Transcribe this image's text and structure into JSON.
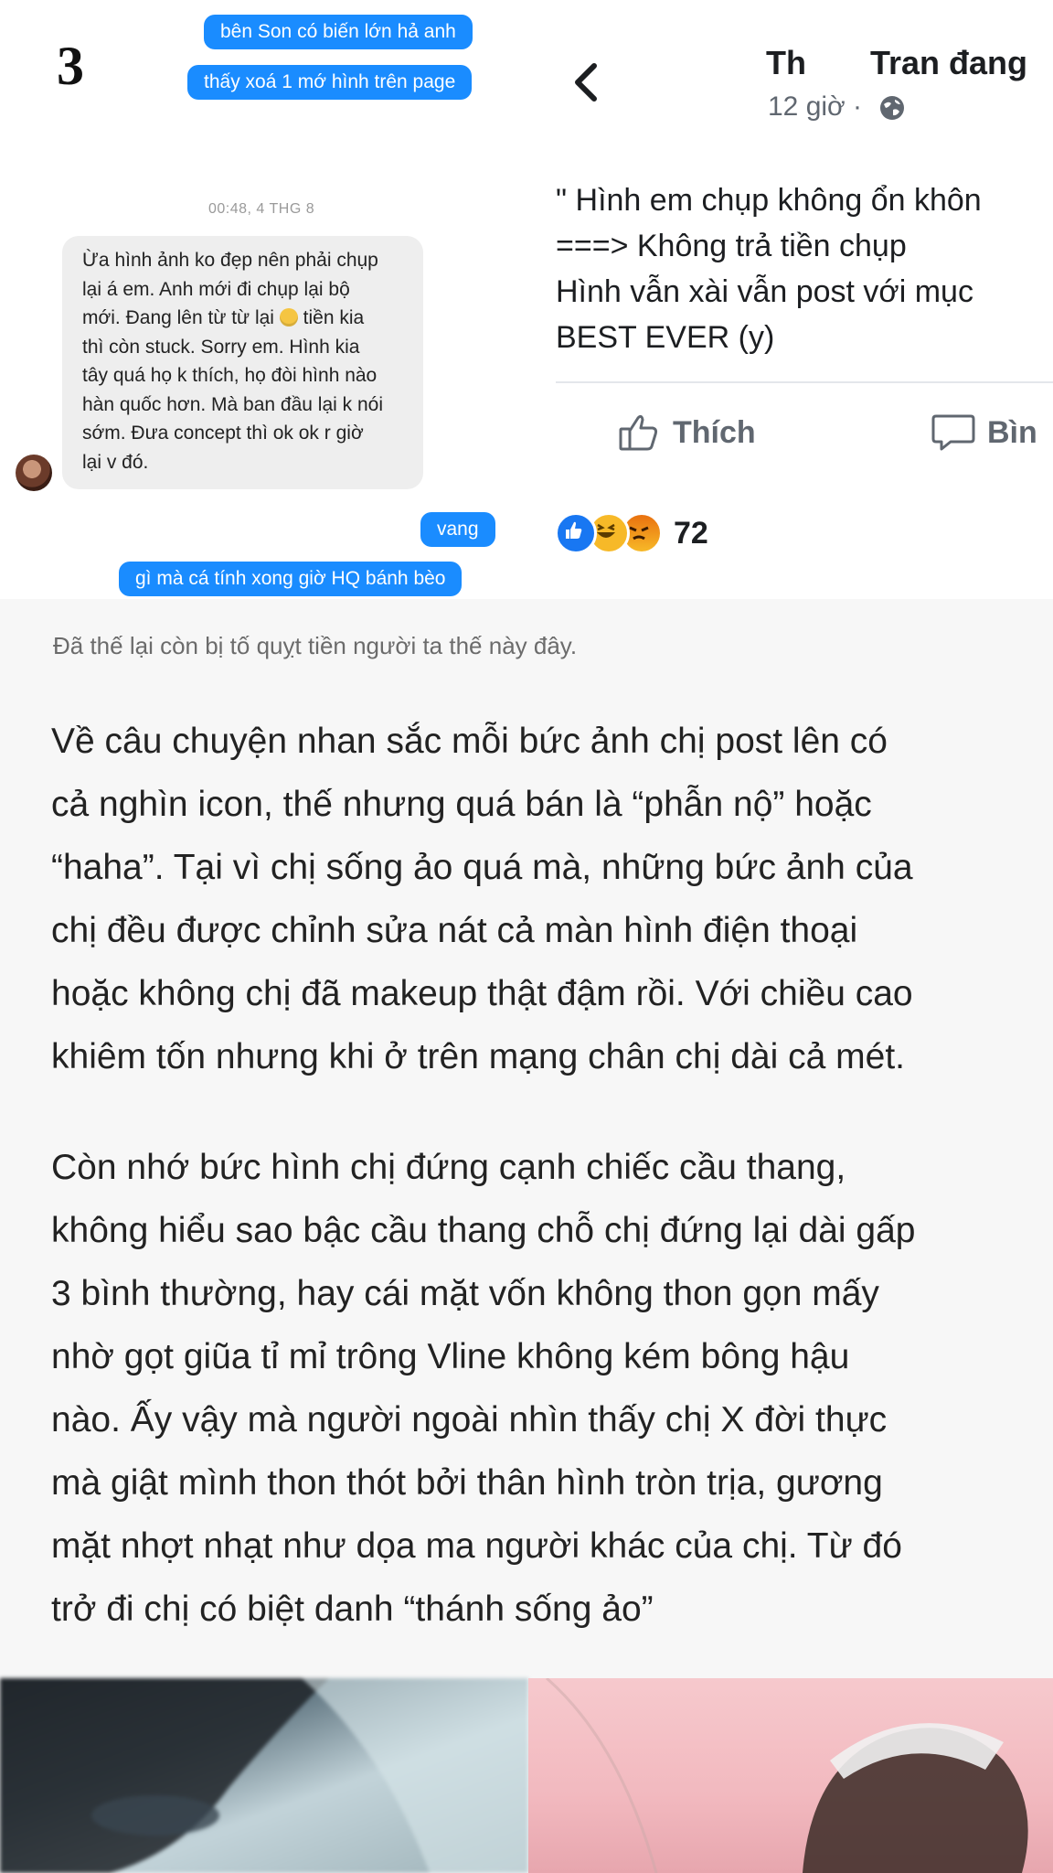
{
  "figure_number": "3",
  "messenger": {
    "sent_top": [
      "bên Son có biến lớn hả anh",
      "thấy xoá 1 mớ hình trên page"
    ],
    "timestamp": "00:48, 4 THG 8",
    "received_lines": [
      "Ừa hình ảnh ko đẹp nên phải chụp",
      "lại á em. Anh mới đi chụp lại bộ",
      "mới. Đang lên từ từ lại",
      "tiền kia",
      "thì còn stuck. Sorry em. Hình kia",
      "tây quá họ k thích, họ đòi hình nào",
      "hàn quốc hơn. Mà ban đầu lại k nói",
      "sớm. Đưa concept thì ok ok r giờ",
      "lại v đó."
    ],
    "sent_bottom": [
      "vang",
      "gì mà cá tính xong giờ HQ bánh bèo"
    ]
  },
  "facebook": {
    "name_part1": "Th",
    "name_part2": "Tran đang",
    "time": "12 giờ ·",
    "post_lines": [
      "\" Hình em chụp không ổn khôn",
      "===> Không trả tiền chụp",
      "Hình vẫn xài vẫn post với mục",
      "BEST EVER (y)"
    ],
    "like_label": "Thích",
    "comment_label": "Bìn",
    "reaction_count": "72"
  },
  "article": {
    "caption": "Đã thế lại còn bị tố quỵt tiền người ta thế này đây.",
    "paragraph1": [
      "Về câu chuyện nhan sắc mỗi bức ảnh chị post lên có",
      "cả nghìn icon, thế nhưng quá bán là “phẫn nộ” hoặc",
      "“haha”. Tại vì chị sống ảo quá mà, những bức ảnh của",
      "chị đều được chỉnh sửa nát cả màn hình điện thoại",
      "hoặc không chị đã makeup thật đậm rồi. Với chiều cao",
      "khiêm tốn nhưng khi ở trên mạng chân chị dài cả mét."
    ],
    "paragraph2": [
      "Còn nhớ bức hình chị đứng cạnh chiếc cầu thang,",
      "không hiểu sao bậc cầu thang chỗ chị đứng lại dài gấp",
      "3 bình thường, hay cái mặt vốn không thon gọn mấy",
      "nhờ gọt giũa tỉ mỉ trông Vline không kém bông hậu",
      "nào. Ấy vậy mà người ngoài nhìn thấy chị X đời thực",
      "mà giật mình thon thót bởi thân hình tròn trịa, gương",
      "mặt nhợt nhạt như dọa ma người khác của chị. Từ đó",
      "trở đi chị có biệt danh “thánh sống ảo”"
    ]
  },
  "colors": {
    "messenger_blue": "#1a8cff",
    "fb_blue": "#1877f2",
    "text_dark": "#222222"
  }
}
